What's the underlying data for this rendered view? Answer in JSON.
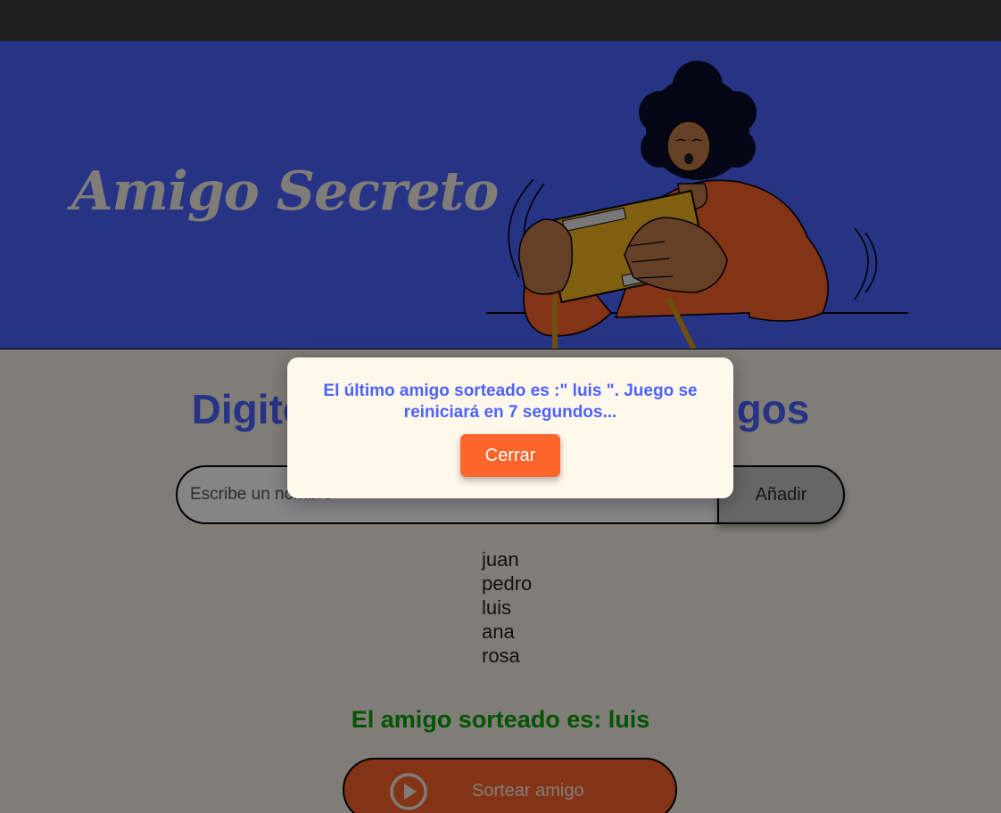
{
  "header": {
    "title": "Amigo Secreto",
    "illustration": "person-shaking-gift-box-illustration"
  },
  "main": {
    "title": "Digite el nombre de sus amigos",
    "input_placeholder": "Escribe un nombre",
    "input_value": "",
    "add_label": "Añadir",
    "friends": [
      "juan",
      "pedro",
      "luis",
      "ana",
      "rosa"
    ],
    "result": "El amigo sorteado es: luis",
    "draw_label": "Sortear amigo",
    "draw_icon": "play-circle-icon"
  },
  "modal": {
    "message": "El último amigo sorteado es :\" luis \". Juego se reiniciará en 7 segundos...",
    "close_label": "Cerrar"
  },
  "colors": {
    "header_bg": "#4b63ff",
    "accent": "#fe652b",
    "title_blue": "#4b63ff",
    "result_green": "#05a005",
    "page_bg": "#f5f0e6"
  }
}
